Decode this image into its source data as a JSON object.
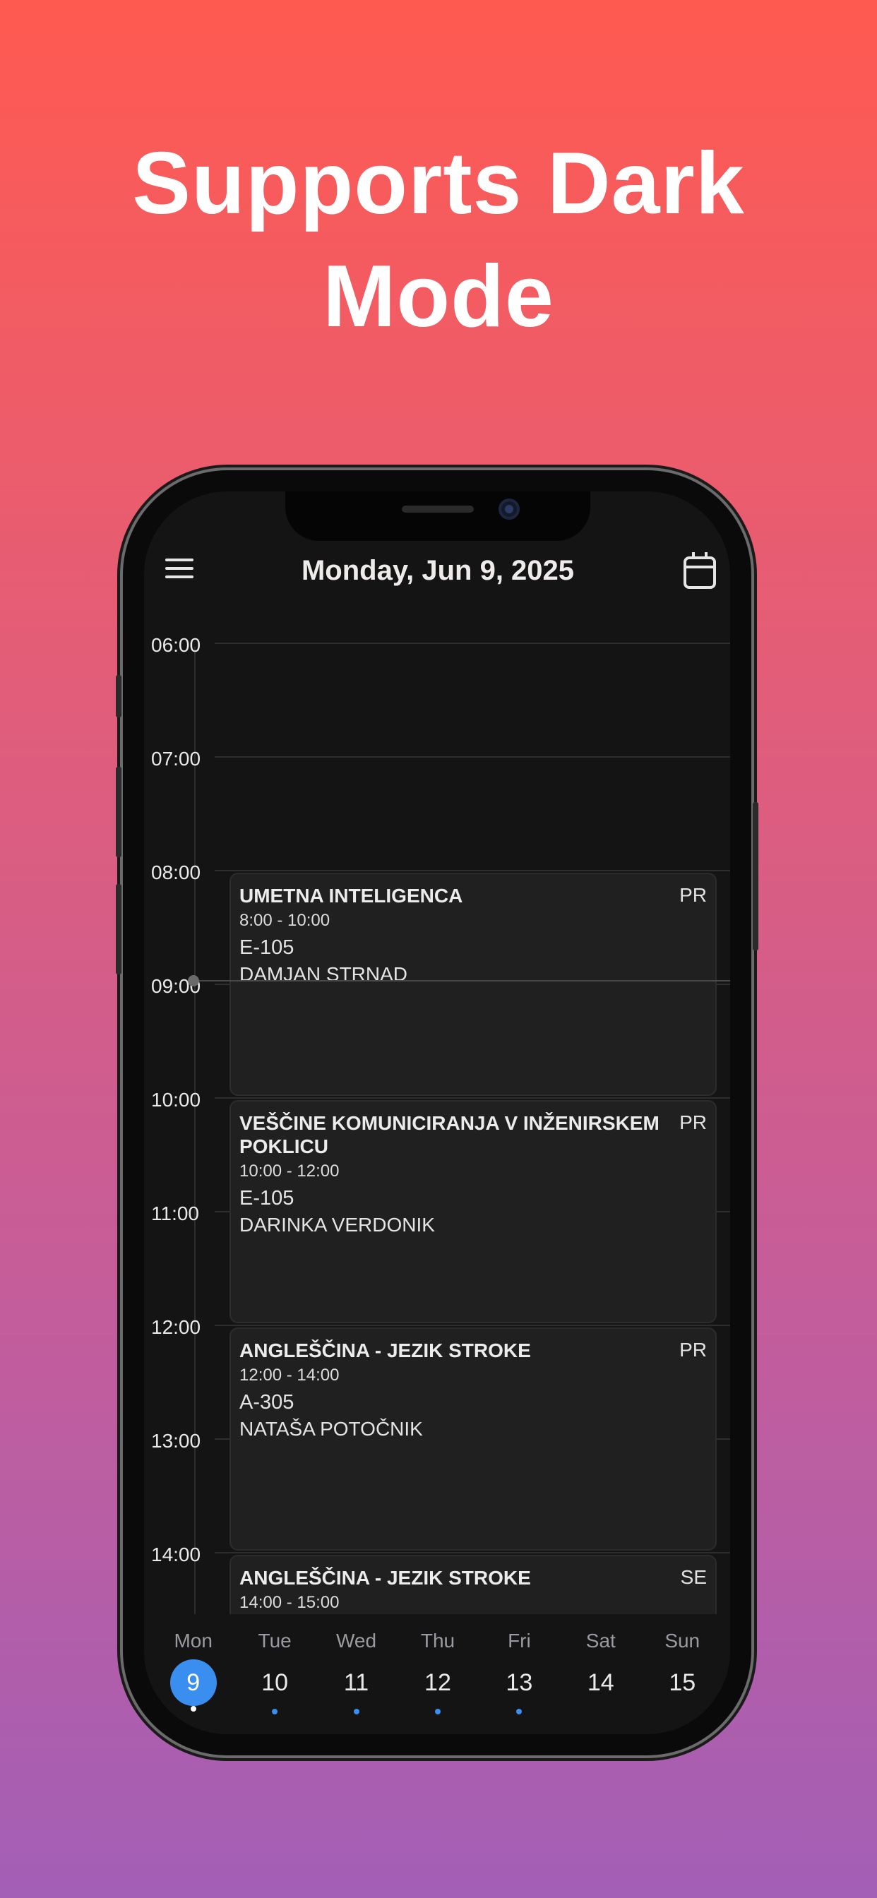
{
  "headline": [
    "Supports Dark",
    "Mode"
  ],
  "header": {
    "title": "Monday, Jun 9, 2025",
    "menu_icon": "hamburger-menu-icon",
    "calendar_icon": "calendar-icon"
  },
  "hours": [
    "06:00",
    "07:00",
    "08:00",
    "09:00",
    "10:00",
    "11:00",
    "12:00",
    "13:00",
    "14:00"
  ],
  "events": [
    {
      "title": "UMETNA INTELIGENCA",
      "type": "PR",
      "time": "8:00 - 10:00",
      "room": "E-105",
      "teacher": "DAMJAN STRNAD"
    },
    {
      "title": "VEŠČINE KOMUNICIRANJA V INŽENIRSKEM POKLICU",
      "type": "PR",
      "time": "10:00 - 12:00",
      "room": "E-105",
      "teacher": "DARINKA VERDONIK"
    },
    {
      "title": "ANGLEŠČINA - JEZIK STROKE",
      "type": "PR",
      "time": "12:00 - 14:00",
      "room": "A-305",
      "teacher": "NATAŠA POTOČNIK"
    },
    {
      "title": "ANGLEŠČINA - JEZIK STROKE",
      "type": "SE",
      "time": "14:00 - 15:00",
      "room": "",
      "teacher": ""
    }
  ],
  "week": {
    "days": [
      {
        "name": "Mon",
        "num": "9",
        "selected": true,
        "has_events": true
      },
      {
        "name": "Tue",
        "num": "10",
        "selected": false,
        "has_events": true
      },
      {
        "name": "Wed",
        "num": "11",
        "selected": false,
        "has_events": true
      },
      {
        "name": "Thu",
        "num": "12",
        "selected": false,
        "has_events": true
      },
      {
        "name": "Fri",
        "num": "13",
        "selected": false,
        "has_events": true
      },
      {
        "name": "Sat",
        "num": "14",
        "selected": false,
        "has_events": false
      },
      {
        "name": "Sun",
        "num": "15",
        "selected": false,
        "has_events": false
      }
    ]
  },
  "colors": {
    "accent": "#3a8ef0",
    "background": "#141414",
    "card": "#202020"
  }
}
